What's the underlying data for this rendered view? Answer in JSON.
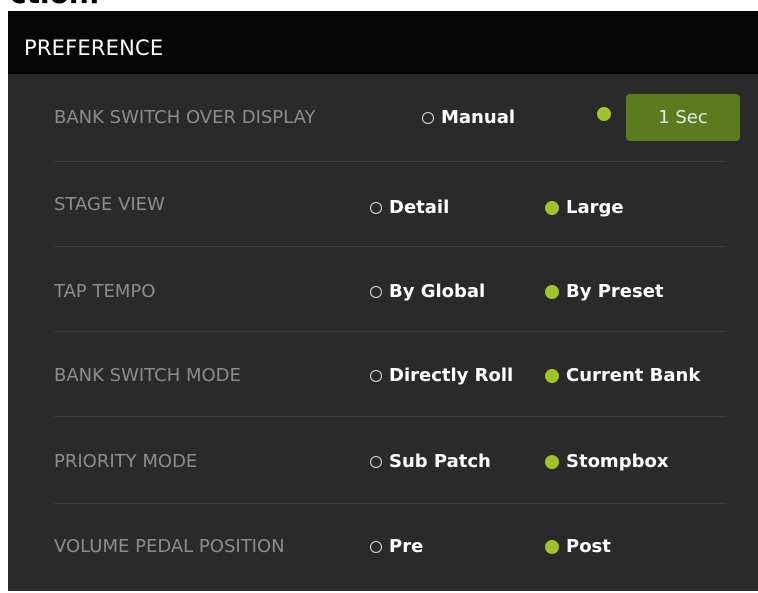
{
  "cut_text": "ction:",
  "panel": {
    "title": "PREFERENCE",
    "accent_color": "#9ec42a",
    "button_color": "#5c7a1e"
  },
  "rows": [
    {
      "label": "BANK SWITCH OVER DISPLAY",
      "options": [
        "Manual"
      ],
      "selected": "1 Sec",
      "button_label": "1 Sec"
    },
    {
      "label": "STAGE VIEW",
      "options": [
        "Detail",
        "Large"
      ],
      "selected": "Large"
    },
    {
      "label": "TAP TEMPO",
      "options": [
        "By Global",
        "By Preset"
      ],
      "selected": "By Preset"
    },
    {
      "label": "BANK SWITCH MODE",
      "options": [
        "Directly Roll",
        "Current Bank"
      ],
      "selected": "Current Bank"
    },
    {
      "label": "PRIORITY MODE",
      "options": [
        "Sub Patch",
        "Stompbox"
      ],
      "selected": "Stompbox"
    },
    {
      "label": "VOLUME PEDAL POSITION",
      "options": [
        "Pre",
        "Post"
      ],
      "selected": "Post"
    }
  ]
}
